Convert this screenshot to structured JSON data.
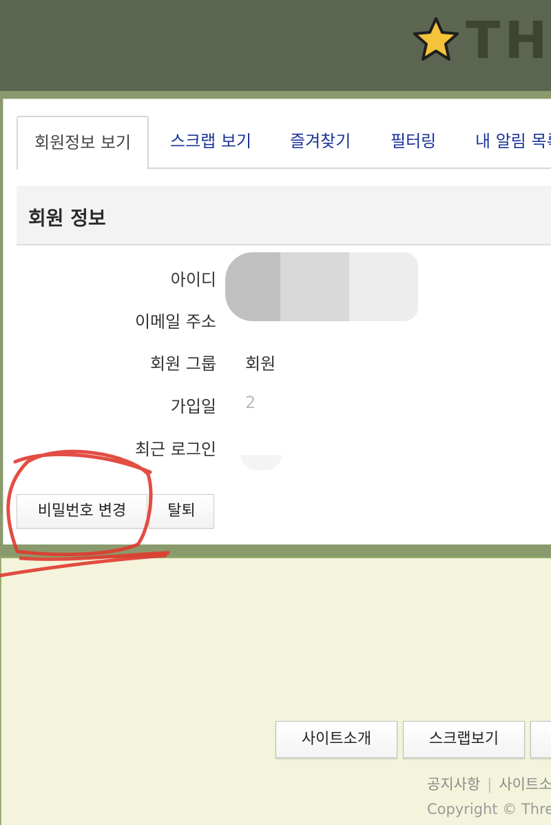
{
  "header": {
    "logo_text": "THI",
    "accent": "#f5c33b",
    "bg_color": "#5b6550"
  },
  "tabs": [
    {
      "label": "회원정보 보기",
      "active": true
    },
    {
      "label": "스크랩 보기",
      "active": false
    },
    {
      "label": "즐겨찾기",
      "active": false
    },
    {
      "label": "필터링",
      "active": false
    },
    {
      "label": "내 알림 목록",
      "active": false
    }
  ],
  "section": {
    "title": "회원 정보"
  },
  "fields": [
    {
      "label": "아이디",
      "value": ""
    },
    {
      "label": "이메일 주소",
      "value": ""
    },
    {
      "label": "회원 그룹",
      "value": "회원"
    },
    {
      "label": "가입일",
      "value": "2"
    },
    {
      "label": "최근 로그인",
      "value": ""
    }
  ],
  "actions": {
    "change_password_label": "비밀번호 변경",
    "withdraw_label": "탈퇴"
  },
  "footer": {
    "buttons": [
      {
        "label": "사이트소개"
      },
      {
        "label": "스크랩보기"
      },
      {
        "label": ""
      }
    ],
    "links": [
      "공지사항",
      "사이트소"
    ],
    "copyright": "Copyright © Threa",
    "bg_color": "#f4f4dc"
  },
  "annotation": {
    "color": "#e03a2f",
    "shape": "hand-drawn-circle"
  }
}
